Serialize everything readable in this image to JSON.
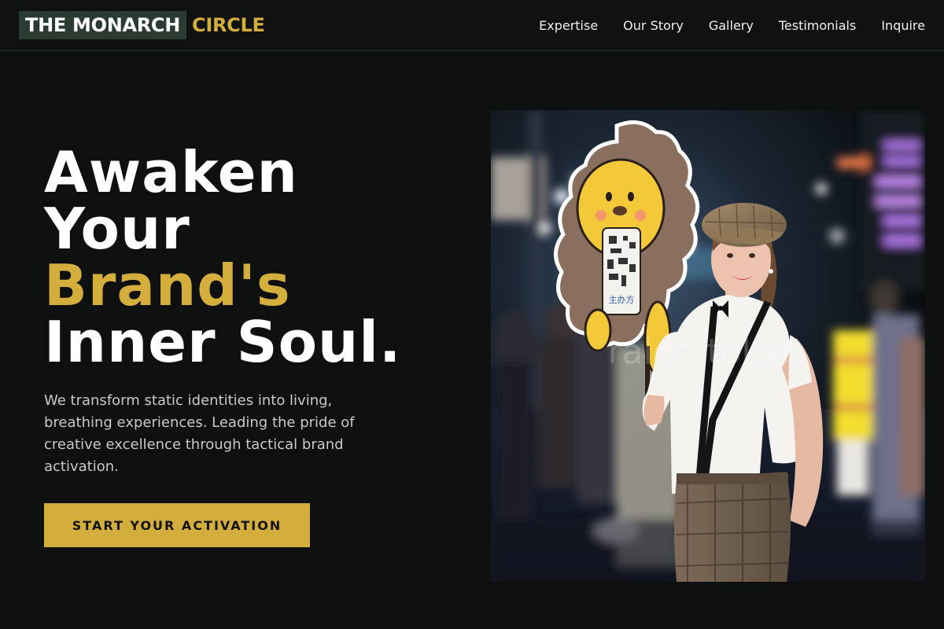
{
  "brand": {
    "name_main": "THE MONARCH",
    "name_accent": "CIRCLE"
  },
  "nav": {
    "items": [
      {
        "label": "Expertise"
      },
      {
        "label": "Our Story"
      },
      {
        "label": "Gallery"
      },
      {
        "label": "Testimonials"
      },
      {
        "label": "Inquire"
      }
    ]
  },
  "hero": {
    "headline_lines": [
      "Awaken",
      "Your",
      "Brand's",
      "Inner Soul."
    ],
    "highlight_line_index": 2,
    "description": "We transform static identities into living, breathing experiences. Leading the pride of creative excellence through tactical brand activation.",
    "cta_label": "START YOUR ACTIVATION"
  },
  "image": {
    "watermark": "ralon.tokyo",
    "sign_text": "主办方"
  },
  "colors": {
    "background": "#0d100f",
    "accent": "#d4ae3d",
    "logo_bg": "#2a3b32",
    "text": "#ffffff",
    "muted_text": "#c6cbc8"
  }
}
